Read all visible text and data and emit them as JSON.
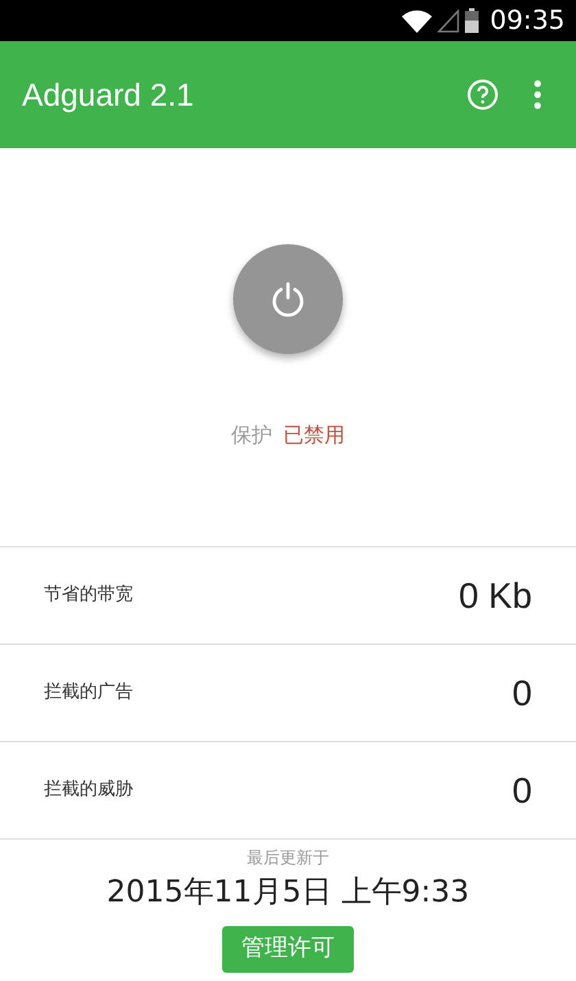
{
  "status_bar": {
    "time": "09:35"
  },
  "app_bar": {
    "title": "Adguard 2.1"
  },
  "protection": {
    "label": "保护",
    "status": "已禁用",
    "enabled": false
  },
  "stats": [
    {
      "label": "节省的带宽",
      "value": "0 Kb"
    },
    {
      "label": "拦截的广告",
      "value": "0"
    },
    {
      "label": "拦截的威胁",
      "value": "0"
    }
  ],
  "footer": {
    "caption": "最后更新于",
    "updated": "2015年11月5日 上午9:33",
    "button": "管理许可"
  }
}
